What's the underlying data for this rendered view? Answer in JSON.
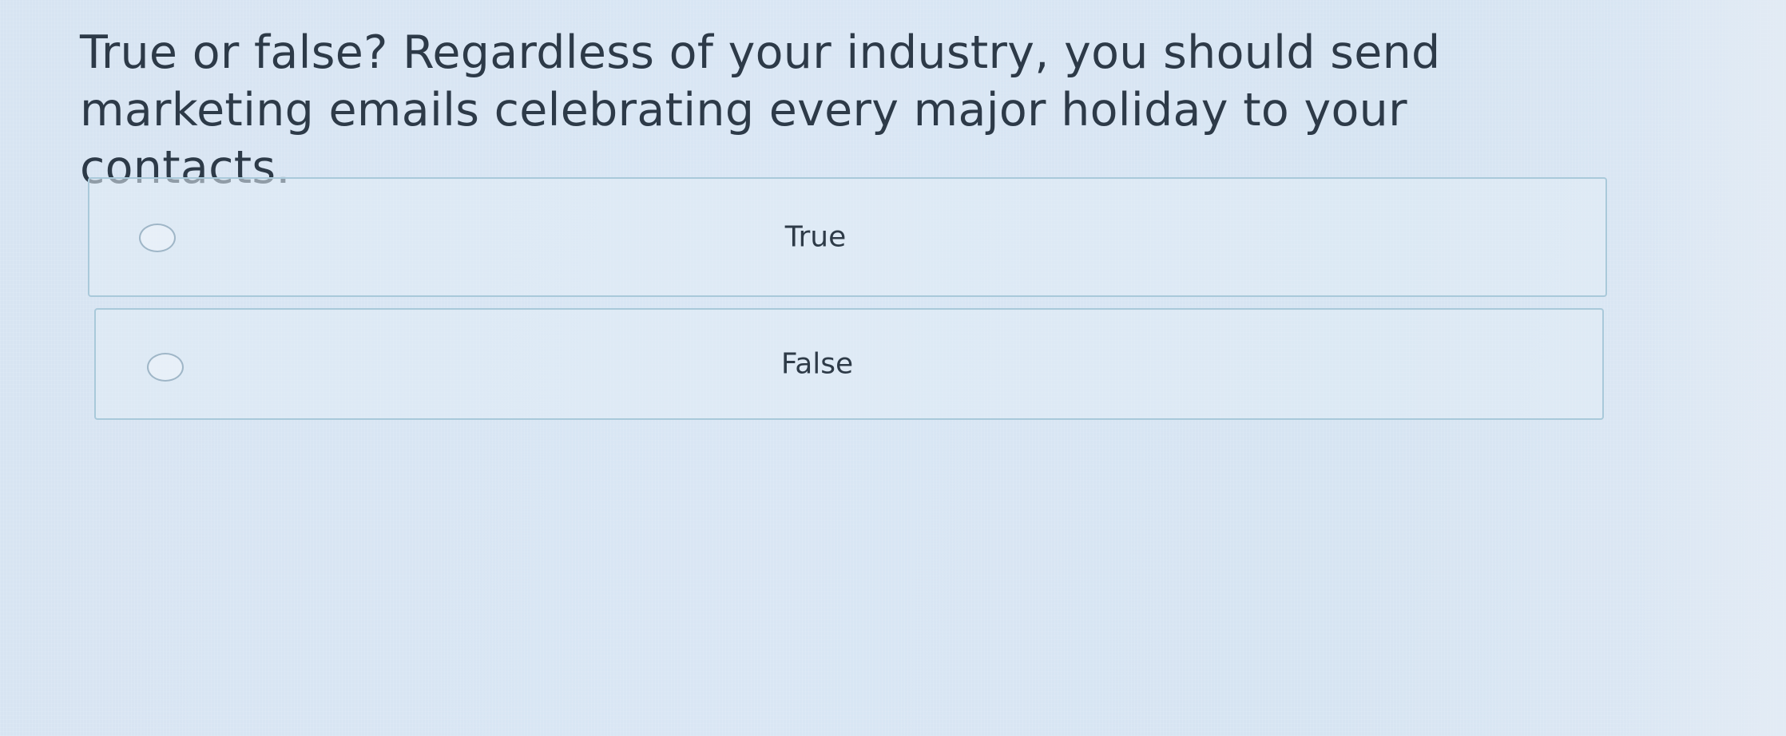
{
  "question": {
    "text": "True or false? Regardless of your industry, you should send marketing emails celebrating every major holiday to your contacts."
  },
  "options": [
    {
      "label": "True",
      "selected": false,
      "icon": "radio-unchecked-icon"
    },
    {
      "label": "False",
      "selected": false,
      "icon": "radio-unchecked-icon"
    }
  ],
  "colors": {
    "background": "#d8e5f3",
    "border": "#a9c9da",
    "text": "#2d3a48"
  }
}
